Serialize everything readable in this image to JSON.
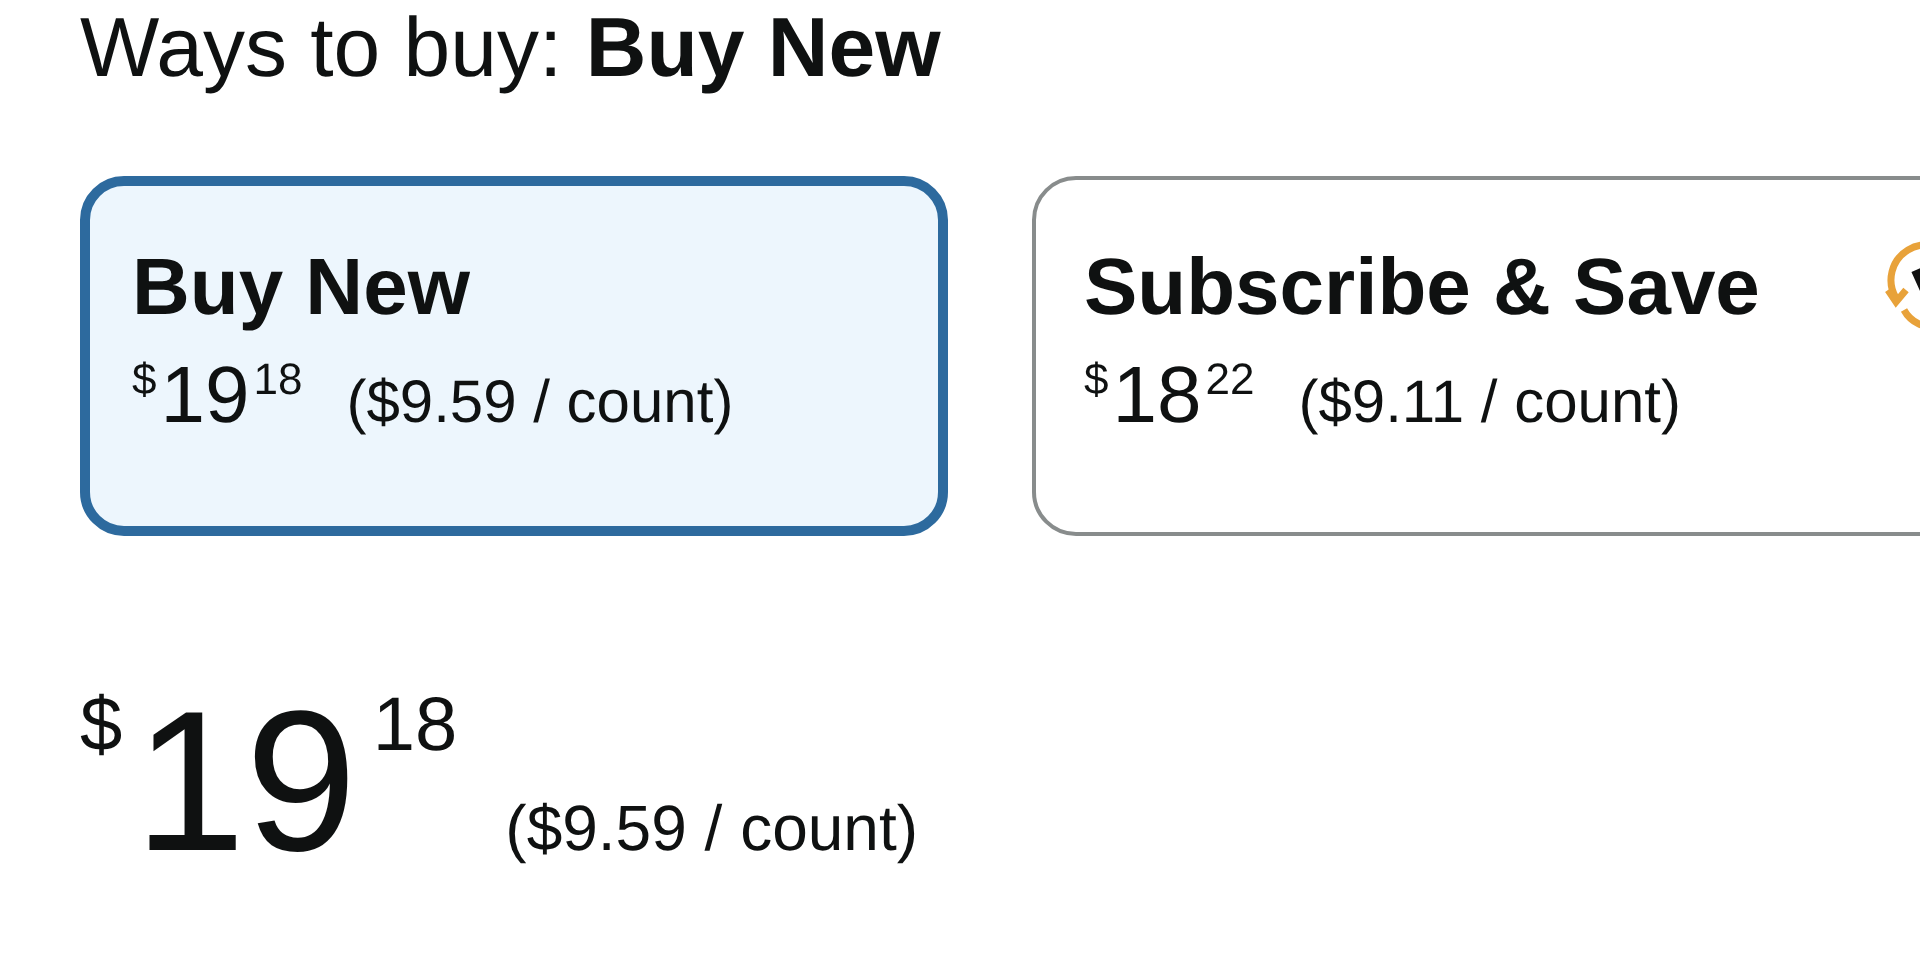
{
  "heading": "Ways to buy: **Buy New**",
  "options": [
    {
      "title": "Buy New",
      "selected": true,
      "currency": "$",
      "whole": "19",
      "fraction": "18",
      "unit_price": "($9.59 / count)",
      "subscribe_icon": false
    },
    {
      "title": "Subscribe & Save",
      "selected": false,
      "currency": "$",
      "whole": "18",
      "fraction": "22",
      "unit_price": "($9.11 / count)",
      "subscribe_icon": true
    }
  ],
  "price": {
    "currency": "$",
    "whole": "19",
    "fraction": "18",
    "unit_price": "($9.59 / count)"
  }
}
